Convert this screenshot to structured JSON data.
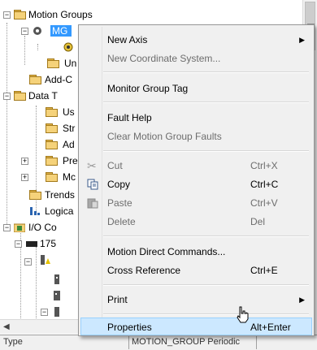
{
  "tree": {
    "nodes": [
      {
        "label": "Motion Groups"
      },
      {
        "label": "MG"
      },
      {
        "label": ""
      },
      {
        "label": "Un"
      },
      {
        "label": "Add-C"
      },
      {
        "label": "Data T"
      },
      {
        "label": "Us"
      },
      {
        "label": "Str"
      },
      {
        "label": "Ad"
      },
      {
        "label": "Pre"
      },
      {
        "label": "Mc"
      },
      {
        "label": "Trends"
      },
      {
        "label": "Logica"
      },
      {
        "label": "I/O Co"
      },
      {
        "label": "175"
      }
    ]
  },
  "context_menu": {
    "items": [
      {
        "label": "New Axis",
        "submenu": true
      },
      {
        "label": "New Coordinate System...",
        "disabled": true
      },
      {
        "label": "Monitor Group Tag"
      },
      {
        "label": "Fault Help"
      },
      {
        "label": "Clear Motion Group Faults",
        "disabled": true
      },
      {
        "label": "Cut",
        "shortcut": "Ctrl+X",
        "disabled": true
      },
      {
        "label": "Copy",
        "shortcut": "Ctrl+C"
      },
      {
        "label": "Paste",
        "shortcut": "Ctrl+V",
        "disabled": true
      },
      {
        "label": "Delete",
        "shortcut": "Del",
        "disabled": true
      },
      {
        "label": "Motion Direct Commands..."
      },
      {
        "label": "Cross Reference",
        "shortcut": "Ctrl+E"
      },
      {
        "label": "Print",
        "submenu": true
      },
      {
        "label": "Properties",
        "shortcut": "Alt+Enter",
        "highlighted": true
      }
    ]
  },
  "statusbar": {
    "type_label": "Type",
    "type_value": "MOTION_GROUP Periodic"
  },
  "colors": {
    "selection": "#3399ff",
    "highlight": "#cce8ff",
    "folder": "#f5d27a"
  }
}
